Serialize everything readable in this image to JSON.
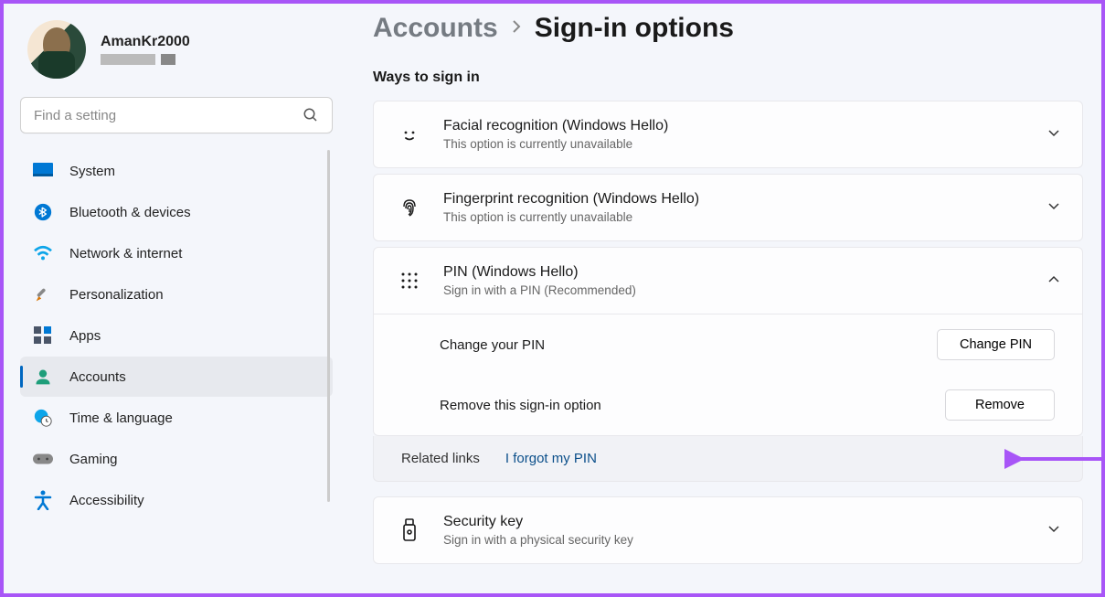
{
  "profile": {
    "username": "AmanKr2000"
  },
  "search": {
    "placeholder": "Find a setting"
  },
  "sidebar": {
    "items": [
      {
        "label": "System"
      },
      {
        "label": "Bluetooth & devices"
      },
      {
        "label": "Network & internet"
      },
      {
        "label": "Personalization"
      },
      {
        "label": "Apps"
      },
      {
        "label": "Accounts"
      },
      {
        "label": "Time & language"
      },
      {
        "label": "Gaming"
      },
      {
        "label": "Accessibility"
      }
    ]
  },
  "breadcrumb": {
    "parent": "Accounts",
    "current": "Sign-in options"
  },
  "section": {
    "ways": "Ways to sign in"
  },
  "cards": {
    "face": {
      "title": "Facial recognition (Windows Hello)",
      "sub": "This option is currently unavailable"
    },
    "finger": {
      "title": "Fingerprint recognition (Windows Hello)",
      "sub": "This option is currently unavailable"
    },
    "pin": {
      "title": "PIN (Windows Hello)",
      "sub": "Sign in with a PIN (Recommended)"
    },
    "key": {
      "title": "Security key",
      "sub": "Sign in with a physical security key"
    }
  },
  "pin_options": {
    "change_label": "Change your PIN",
    "change_btn": "Change PIN",
    "remove_label": "Remove this sign-in option",
    "remove_btn": "Remove"
  },
  "related": {
    "label": "Related links",
    "link": "I forgot my PIN"
  },
  "colors": {
    "accent": "#0067c0",
    "annotation": "#a855f7"
  }
}
